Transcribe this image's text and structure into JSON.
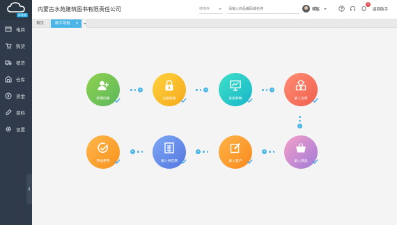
{
  "app": {
    "logo_badge": "标准版",
    "company": "内蒙古水苑建筑图书有限责任公司"
  },
  "sidebar": {
    "items": [
      {
        "label": "电商",
        "icon": "store-icon"
      },
      {
        "label": "购货",
        "icon": "cart-icon"
      },
      {
        "label": "销货",
        "icon": "truck-icon"
      },
      {
        "label": "仓库",
        "icon": "warehouse-icon"
      },
      {
        "label": "资金",
        "icon": "money-icon"
      },
      {
        "label": "资料",
        "icon": "pen-icon"
      },
      {
        "label": "设置",
        "icon": "gear-icon"
      }
    ]
  },
  "header": {
    "stock_select": "搜库存",
    "search_placeholder": "请输入商品编码或名称",
    "user": "朝辉",
    "notification_count": "1",
    "back_link": "返回助手"
  },
  "tabs": {
    "home": "首页",
    "guide": "新手导航",
    "close": "×"
  },
  "guide": {
    "steps": [
      {
        "label": "新增同事",
        "color_a": "#8fd14f",
        "color_b": "#5cb85c"
      },
      {
        "label": "分配权限",
        "color_a": "#ffd23f",
        "color_b": "#f5a91a"
      },
      {
        "label": "系统参数",
        "color_a": "#3fe0c8",
        "color_b": "#16b6c9"
      },
      {
        "label": "录入仓库",
        "color_a": "#ff8c72",
        "color_b": "#f0604f"
      },
      {
        "label": "录入商品",
        "color_a": "#f5a0c8",
        "color_b": "#a07ad8"
      },
      {
        "label": "录入客户",
        "color_a": "#ffb347",
        "color_b": "#f98a1e"
      },
      {
        "label": "录入供应商",
        "color_a": "#7fa9f5",
        "color_b": "#5276e0"
      },
      {
        "label": "开始使用",
        "color_a": "#ffb64a",
        "color_b": "#f7921d"
      }
    ]
  }
}
